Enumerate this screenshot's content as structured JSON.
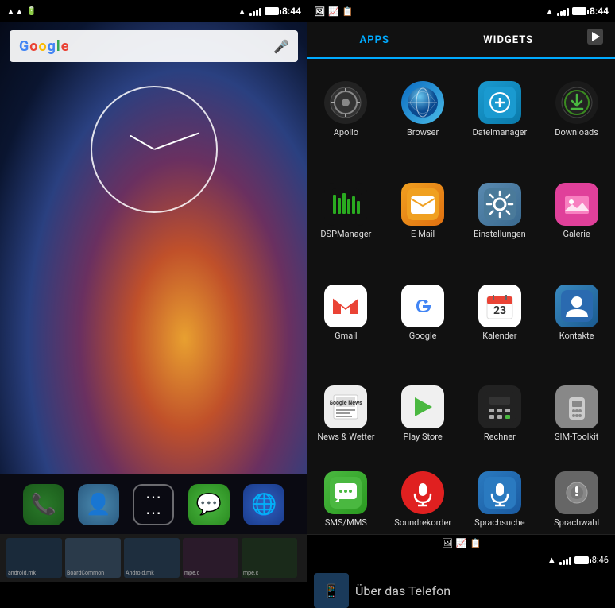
{
  "left": {
    "statusBar": {
      "time": "8:44",
      "icons": [
        "signal",
        "wifi",
        "battery"
      ]
    },
    "searchBar": {
      "text": "Google",
      "placeholder": "Google"
    },
    "dock": {
      "items": [
        {
          "name": "Phone",
          "icon": "📞"
        },
        {
          "name": "Contacts",
          "icon": "👤"
        },
        {
          "name": "Apps",
          "icon": "⋯"
        },
        {
          "name": "Messenger",
          "icon": "💬"
        },
        {
          "name": "Browser",
          "icon": "🌐"
        }
      ]
    }
  },
  "right": {
    "statusBar": {
      "time": "8:44",
      "timeBottom": "8:46"
    },
    "tabs": {
      "apps_label": "APPS",
      "widgets_label": "WIDGETS"
    },
    "apps": [
      {
        "name": "Apollo",
        "iconClass": "icon-apollo"
      },
      {
        "name": "Browser",
        "iconClass": "icon-browser"
      },
      {
        "name": "Dateimanager",
        "iconClass": "icon-dateimanager"
      },
      {
        "name": "Downloads",
        "iconClass": "icon-downloads"
      },
      {
        "name": "DSPManager",
        "iconClass": "icon-dspmanager"
      },
      {
        "name": "E-Mail",
        "iconClass": "icon-email"
      },
      {
        "name": "Einstellungen",
        "iconClass": "icon-einstellungen"
      },
      {
        "name": "Galerie",
        "iconClass": "icon-galerie"
      },
      {
        "name": "Gmail",
        "iconClass": "icon-gmail"
      },
      {
        "name": "Google",
        "iconClass": "icon-google"
      },
      {
        "name": "Kalender",
        "iconClass": "icon-kalender"
      },
      {
        "name": "Kontakte",
        "iconClass": "icon-kontakte"
      },
      {
        "name": "News & Wetter",
        "iconClass": "icon-news"
      },
      {
        "name": "Play Store",
        "iconClass": "icon-playstore"
      },
      {
        "name": "Rechner",
        "iconClass": "icon-rechner"
      },
      {
        "name": "SIM-Toolkit",
        "iconClass": "icon-simtoolkit"
      },
      {
        "name": "SMS/MMS",
        "iconClass": "icon-smsmms"
      },
      {
        "name": "Soundrekorder",
        "iconClass": "icon-soundrekorder"
      },
      {
        "name": "Sprachsuche",
        "iconClass": "icon-sprachsuche"
      },
      {
        "name": "Sprachwahl",
        "iconClass": "icon-sprachwahl"
      }
    ],
    "bottomBar": {
      "text": "Über das Telefon"
    }
  }
}
